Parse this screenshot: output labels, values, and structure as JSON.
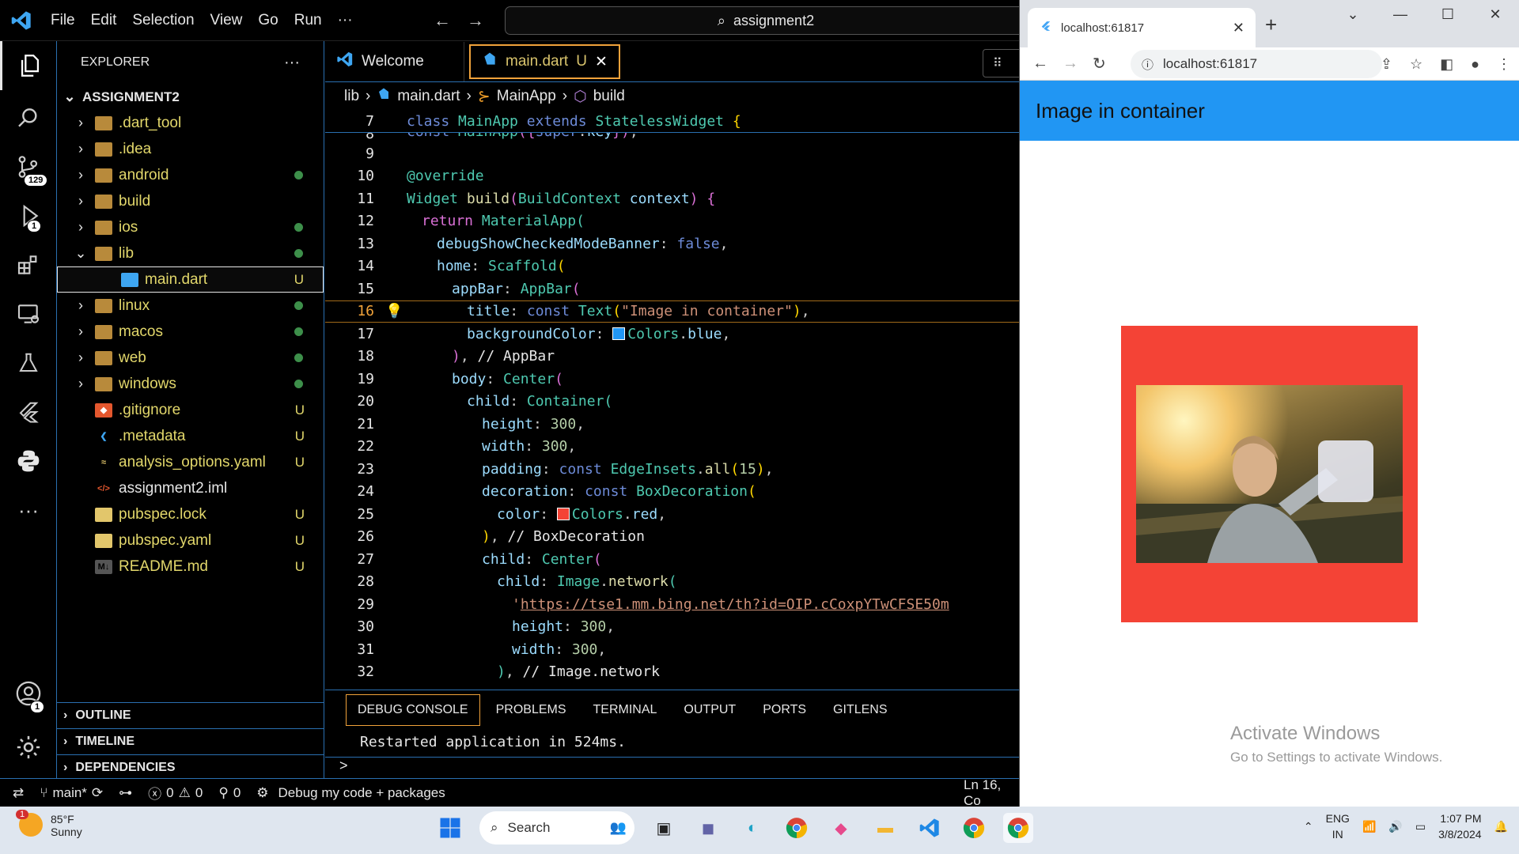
{
  "vscode": {
    "menu": [
      "File",
      "Edit",
      "Selection",
      "View",
      "Go",
      "Run",
      "···"
    ],
    "command_center": "assignment2",
    "activity": {
      "source_control_badge": "129",
      "debug_badge": "1",
      "accounts_badge": "1"
    },
    "explorer": {
      "title": "EXPLORER",
      "more": "···",
      "project": "ASSIGNMENT2",
      "items": [
        {
          "name": ".dart_tool",
          "type": "folder",
          "status": ""
        },
        {
          "name": ".idea",
          "type": "folder",
          "status": ""
        },
        {
          "name": "android",
          "type": "folder",
          "status": "dot"
        },
        {
          "name": "build",
          "type": "folder",
          "status": ""
        },
        {
          "name": "ios",
          "type": "folder",
          "status": "dot"
        },
        {
          "name": "lib",
          "type": "folder-open",
          "status": "dot"
        },
        {
          "name": "main.dart",
          "type": "dart",
          "status": "U"
        },
        {
          "name": "linux",
          "type": "folder",
          "status": "dot"
        },
        {
          "name": "macos",
          "type": "folder",
          "status": "dot"
        },
        {
          "name": "web",
          "type": "folder",
          "status": "dot"
        },
        {
          "name": "windows",
          "type": "folder",
          "status": "dot"
        },
        {
          "name": ".gitignore",
          "type": "git",
          "status": "U"
        },
        {
          "name": ".metadata",
          "type": "flutter",
          "status": "U"
        },
        {
          "name": "analysis_options.yaml",
          "type": "yaml",
          "status": "U"
        },
        {
          "name": "assignment2.iml",
          "type": "xml",
          "status": ""
        },
        {
          "name": "pubspec.lock",
          "type": "lock",
          "status": "U"
        },
        {
          "name": "pubspec.yaml",
          "type": "yaml2",
          "status": "U"
        },
        {
          "name": "README.md",
          "type": "md",
          "status": "U"
        }
      ],
      "sections": [
        "OUTLINE",
        "TIMELINE",
        "DEPENDENCIES"
      ]
    },
    "tabs": [
      {
        "label": "Welcome"
      },
      {
        "label": "main.dart",
        "status": "U",
        "close": "✕"
      }
    ],
    "breadcrumb": [
      "lib",
      "main.dart",
      "MainApp",
      "build"
    ],
    "sticky_line": {
      "num": "7"
    },
    "line_numbers": [
      "8",
      "9",
      "10",
      "11",
      "12",
      "13",
      "14",
      "15",
      "16",
      "17",
      "18",
      "19",
      "20",
      "21",
      "22",
      "23",
      "24",
      "25",
      "26",
      "27",
      "28",
      "29",
      "30",
      "31",
      "32"
    ],
    "current_line": "16",
    "panel": {
      "tabs": [
        "DEBUG CONSOLE",
        "PROBLEMS",
        "TERMINAL",
        "OUTPUT",
        "PORTS",
        "GITLENS"
      ],
      "output": "Restarted application in 524ms.",
      "prompt": ">"
    },
    "status": {
      "branch": "main*",
      "errors": "0",
      "warnings": "0",
      "ports": "0",
      "debug": "Debug my code + packages",
      "position": "Ln 16, Co"
    }
  },
  "browser": {
    "tab_title": "localhost:61817",
    "url": "localhost:61817",
    "app_title": "Image in container",
    "watermark_title": "Activate Windows",
    "watermark_sub": "Go to Settings to activate Windows.",
    "box_color": "#f44336",
    "appbar_color": "#2196f3"
  },
  "taskbar": {
    "weather_temp": "85°F",
    "weather_desc": "Sunny",
    "weather_badge": "1",
    "search": "Search",
    "lang1": "ENG",
    "lang2": "IN",
    "time": "1:07 PM",
    "date": "3/8/2024"
  }
}
